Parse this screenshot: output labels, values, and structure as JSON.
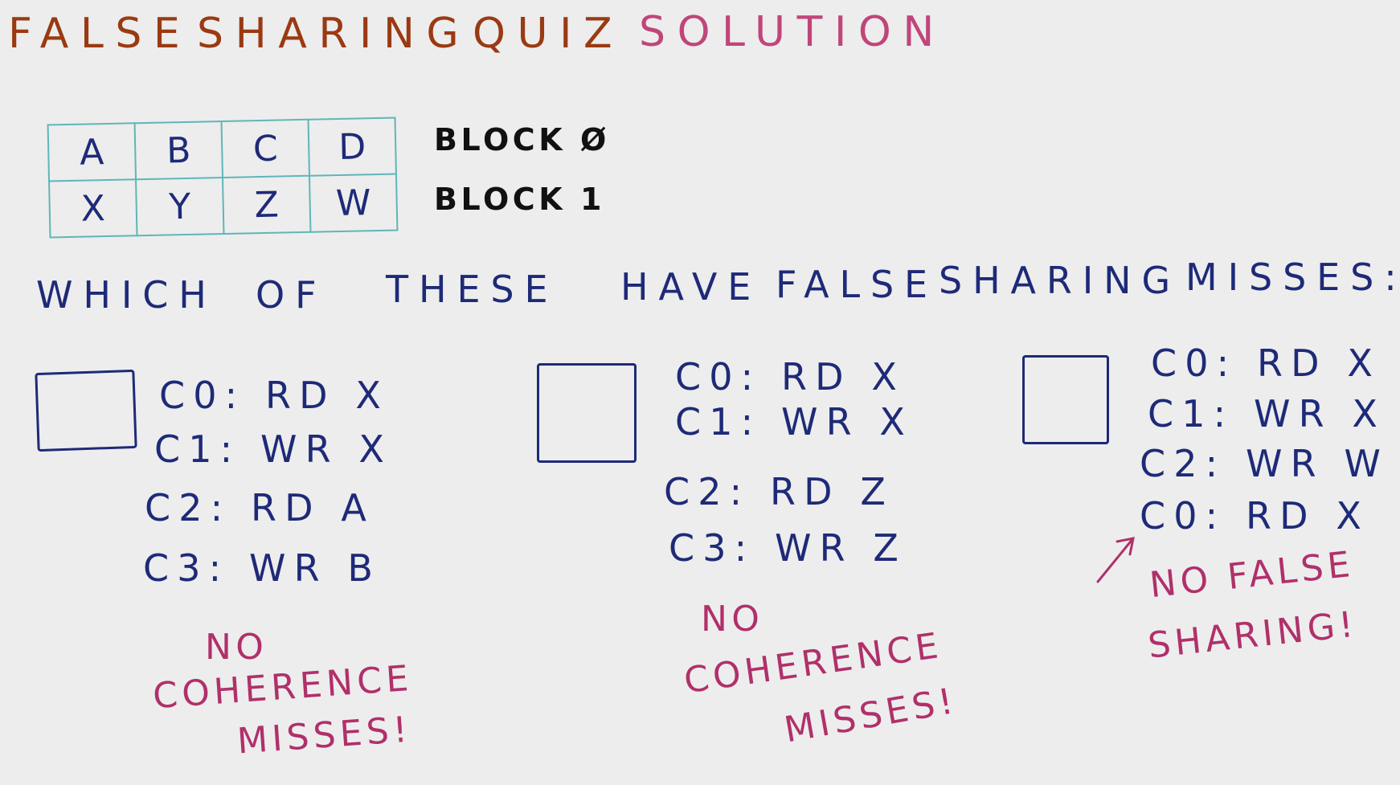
{
  "title": {
    "part1": "FALSE",
    "part2": "SHARING",
    "part3": "QUIZ",
    "part4": "SOLUTION"
  },
  "blocks": {
    "rows": [
      {
        "cells": [
          "A",
          "B",
          "C",
          "D"
        ],
        "label": "BLOCK Ø"
      },
      {
        "cells": [
          "X",
          "Y",
          "Z",
          "W"
        ],
        "label": "BLOCK 1"
      }
    ]
  },
  "question": {
    "words": [
      "WHICH",
      "OF",
      "THESE",
      "HAVE",
      "FALSE",
      "SHARING",
      "MISSES:"
    ]
  },
  "options": [
    {
      "lines": [
        "C0: RD X",
        "C1: WR X",
        "C2: RD A",
        "C3: WR B"
      ],
      "note": [
        "NO",
        "COHERENCE",
        "MISSES!"
      ]
    },
    {
      "lines": [
        "C0: RD X",
        "C1: WR X",
        "C2: RD Z",
        "C3: WR Z"
      ],
      "note": [
        "NO",
        "COHERENCE",
        "MISSES!"
      ]
    },
    {
      "lines": [
        "C0: RD X",
        "C1: WR X",
        "C2: WR W",
        "C0: RD X"
      ],
      "note": [
        "NO FALSE",
        "SHARING!"
      ]
    }
  ],
  "colors": {
    "title": "#9a3a12",
    "accent": "#c0457a",
    "ink": "#1e2a78",
    "note": "#b0306a",
    "grid": "#5fb6b8"
  }
}
